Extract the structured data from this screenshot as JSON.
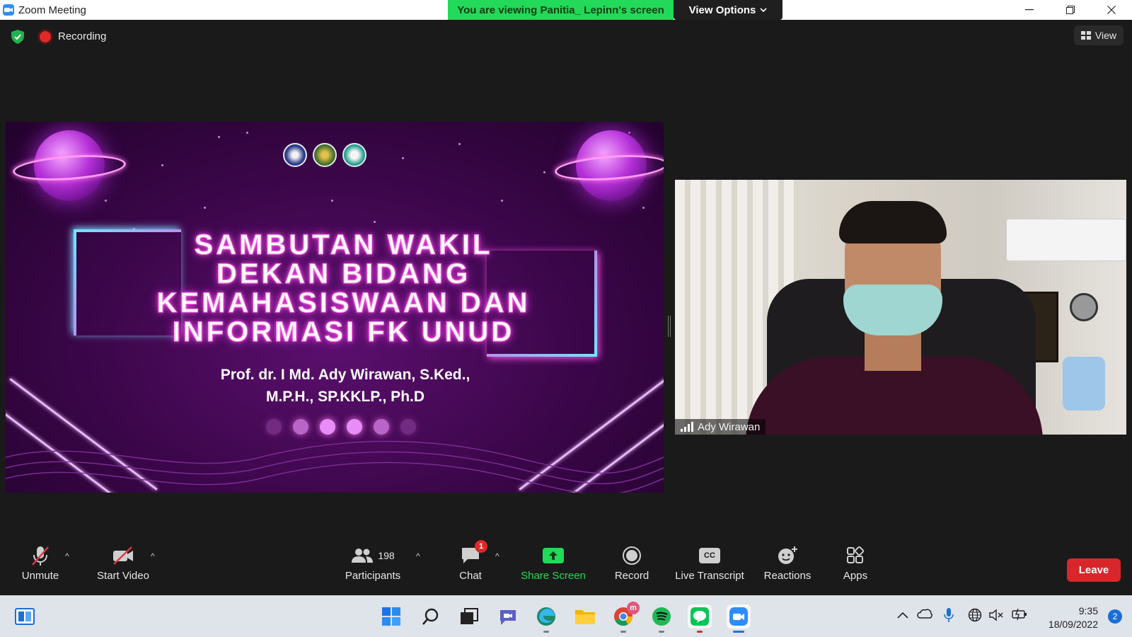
{
  "window": {
    "title": "Zoom Meeting"
  },
  "banner": {
    "viewing_text": "You are viewing Panitia_ Lepinn's screen",
    "view_options_label": "View Options"
  },
  "status": {
    "recording_label": "Recording",
    "view_label": "View"
  },
  "slide": {
    "title_lines": [
      "SAMBUTAN WAKIL",
      "DEKAN BIDANG",
      "KEMAHASISWAAN DAN",
      "INFORMASI FK UNUD"
    ],
    "name_lines": [
      "Prof. dr. I Md. Ady Wirawan, S.Ked.,",
      "M.P.H., SP.KKLP., Ph.D"
    ]
  },
  "video": {
    "participant_name": "Ady Wirawan"
  },
  "toolbar": {
    "unmute_label": "Unmute",
    "start_video_label": "Start Video",
    "participants_label": "Participants",
    "participants_count": "198",
    "chat_label": "Chat",
    "chat_badge": "1",
    "share_screen_label": "Share Screen",
    "record_label": "Record",
    "live_transcript_label": "Live Transcript",
    "cc_text": "CC",
    "reactions_label": "Reactions",
    "apps_label": "Apps",
    "leave_label": "Leave"
  },
  "taskbar": {
    "time": "9:35",
    "date": "18/09/2022",
    "notification_count": "2",
    "chrome_badge": "m"
  },
  "colors": {
    "banner_green": "#23d959",
    "share_green": "#23d959",
    "leave_red": "#d8262a",
    "zoom_blue": "#2d8cff"
  }
}
